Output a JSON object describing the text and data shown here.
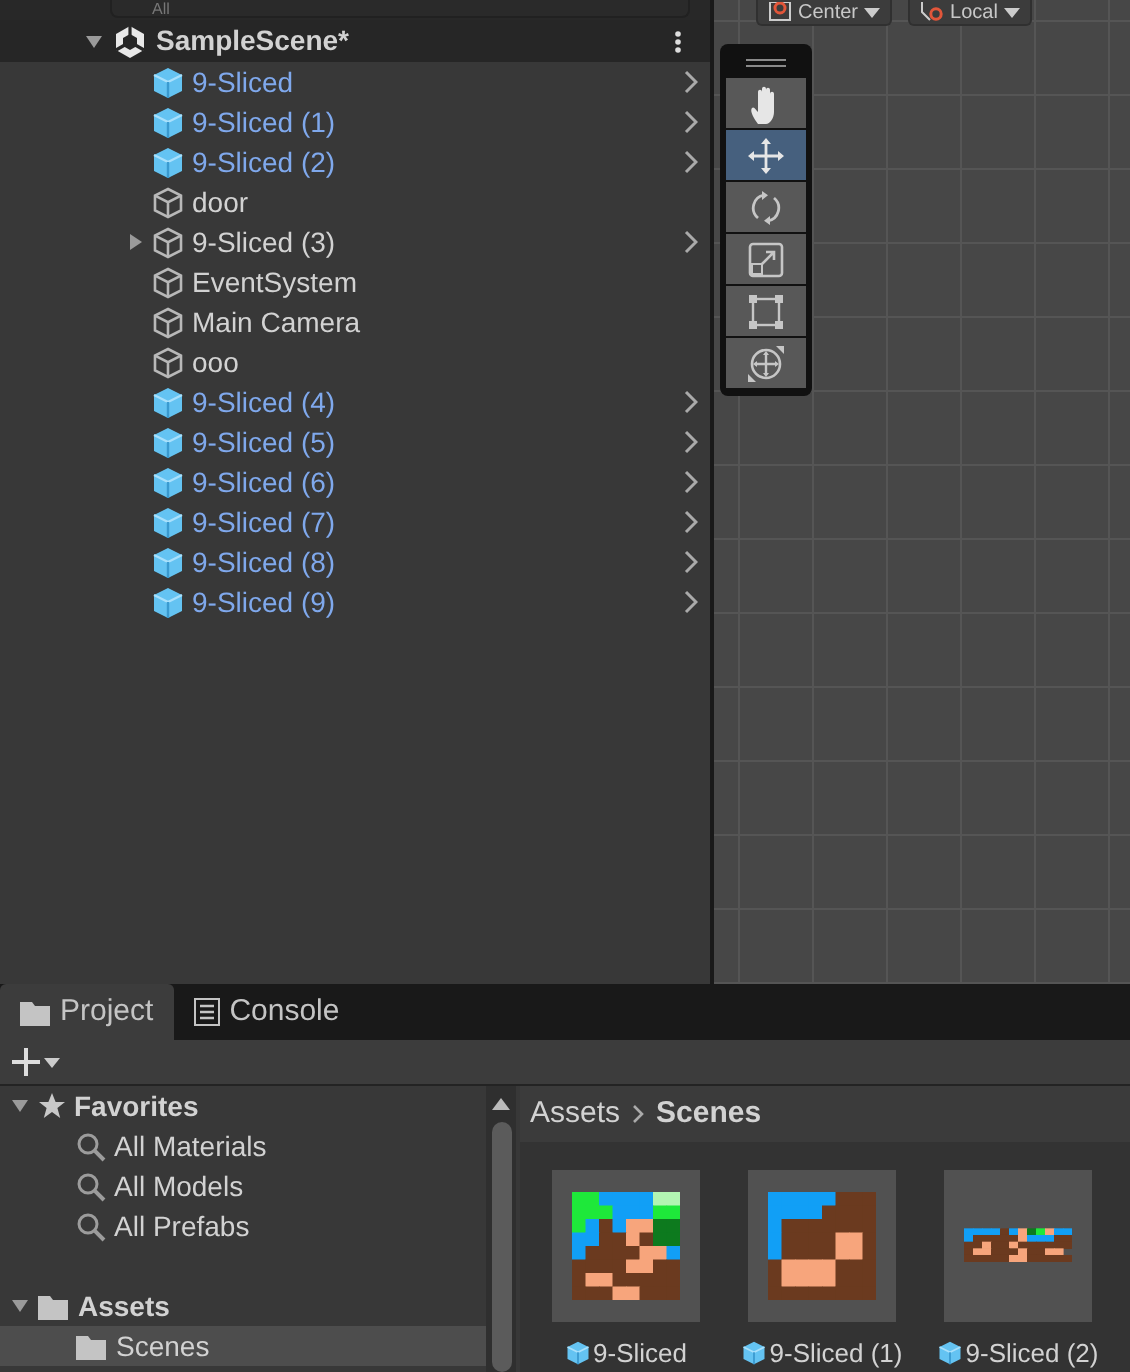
{
  "hierarchy": {
    "search": {
      "placeholder": "All"
    },
    "scene": {
      "name": "SampleScene*",
      "expanded": true
    },
    "items": [
      {
        "label": "9-Sliced",
        "kind": "prefab",
        "expandable": false,
        "chevron": true
      },
      {
        "label": "9-Sliced (1)",
        "kind": "prefab",
        "expandable": false,
        "chevron": true
      },
      {
        "label": "9-Sliced (2)",
        "kind": "prefab",
        "expandable": false,
        "chevron": true
      },
      {
        "label": "door",
        "kind": "object",
        "expandable": false,
        "chevron": false
      },
      {
        "label": "9-Sliced (3)",
        "kind": "object",
        "expandable": true,
        "chevron": true
      },
      {
        "label": "EventSystem",
        "kind": "object",
        "expandable": false,
        "chevron": false
      },
      {
        "label": "Main Camera",
        "kind": "object",
        "expandable": false,
        "chevron": false
      },
      {
        "label": "ooo",
        "kind": "object",
        "expandable": false,
        "chevron": false
      },
      {
        "label": "9-Sliced (4)",
        "kind": "prefab",
        "expandable": false,
        "chevron": true
      },
      {
        "label": "9-Sliced (5)",
        "kind": "prefab",
        "expandable": false,
        "chevron": true
      },
      {
        "label": "9-Sliced (6)",
        "kind": "prefab",
        "expandable": false,
        "chevron": true
      },
      {
        "label": "9-Sliced (7)",
        "kind": "prefab",
        "expandable": false,
        "chevron": true
      },
      {
        "label": "9-Sliced (8)",
        "kind": "prefab",
        "expandable": false,
        "chevron": true
      },
      {
        "label": "9-Sliced (9)",
        "kind": "prefab",
        "expandable": false,
        "chevron": true
      }
    ]
  },
  "scene_view": {
    "toolbar": [
      {
        "label": "Center",
        "kind": "pivot"
      },
      {
        "label": "Local",
        "kind": "space"
      }
    ],
    "tools": [
      {
        "kind": "hand",
        "selected": false
      },
      {
        "kind": "move",
        "selected": true
      },
      {
        "kind": "rotate",
        "selected": false
      },
      {
        "kind": "scale",
        "selected": false
      },
      {
        "kind": "rect",
        "selected": false
      },
      {
        "kind": "transform",
        "selected": false
      }
    ]
  },
  "bottom_tabs": [
    {
      "label": "Project",
      "kind": "folder",
      "selected": true
    },
    {
      "label": "Console",
      "kind": "console",
      "selected": false
    }
  ],
  "project_tree": [
    {
      "label": "Favorites",
      "kind": "favorites",
      "expanded": true,
      "selected": false,
      "children": [
        {
          "label": "All Materials",
          "kind": "search",
          "selected": false
        },
        {
          "label": "All Models",
          "kind": "search",
          "selected": false
        },
        {
          "label": "All Prefabs",
          "kind": "search",
          "selected": false
        }
      ]
    },
    {
      "label": "Assets",
      "kind": "folder",
      "expanded": true,
      "selected": false,
      "children": [
        {
          "label": "Scenes",
          "kind": "folder",
          "selected": true
        }
      ]
    }
  ],
  "breadcrumb": [
    {
      "label": "Assets",
      "current": false
    },
    {
      "label": "Scenes",
      "current": true
    }
  ],
  "assets": [
    {
      "label": "9-Sliced",
      "kind": "picture"
    },
    {
      "label": "9-Sliced (1)",
      "kind": "picture"
    },
    {
      "label": "9-Sliced (2)",
      "kind": "picture"
    }
  ]
}
